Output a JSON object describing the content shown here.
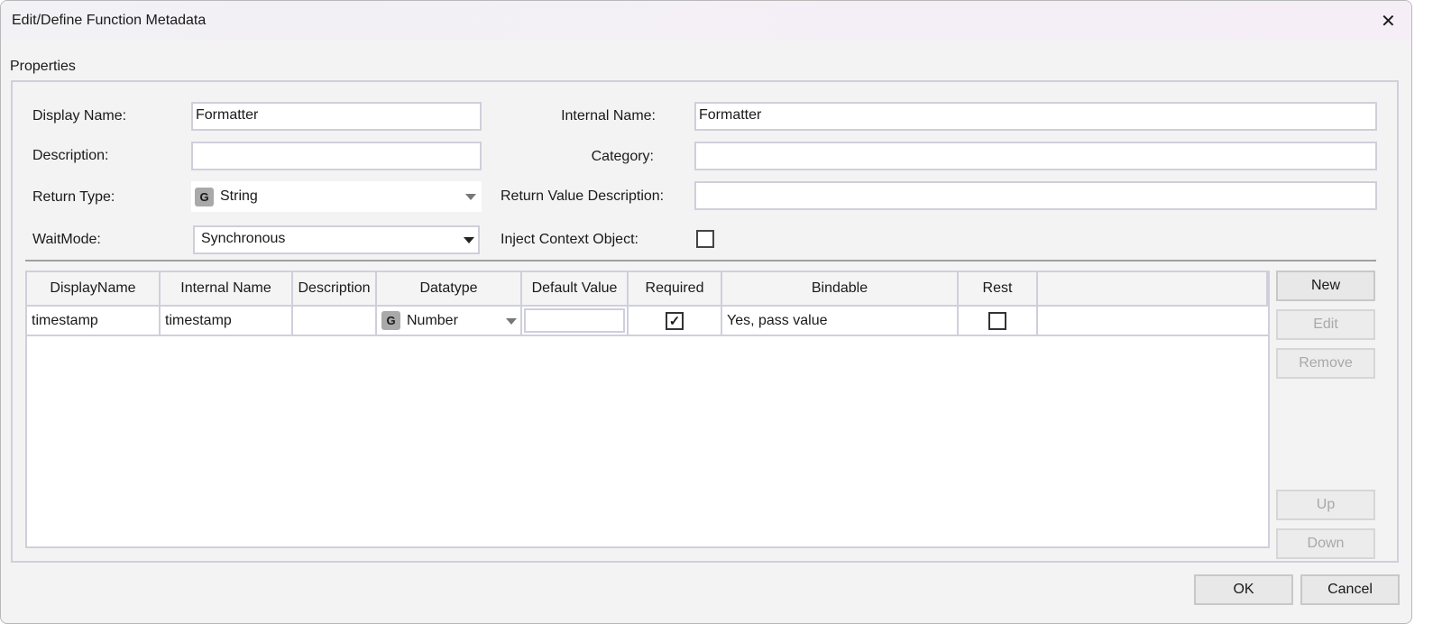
{
  "window": {
    "title": "Edit/Define Function Metadata",
    "close": "✕"
  },
  "group": {
    "label": "Properties"
  },
  "fields": {
    "display_name": {
      "label": "Display Name:",
      "value": "Formatter"
    },
    "description": {
      "label": "Description:",
      "value": ""
    },
    "return_type": {
      "label": "Return Type:",
      "badge": "G",
      "value": "String"
    },
    "wait_mode": {
      "label": "WaitMode:",
      "value": "Synchronous"
    },
    "internal_name": {
      "label": "Internal Name:",
      "value": "Formatter"
    },
    "category": {
      "label": "Category:",
      "value": ""
    },
    "return_value_description": {
      "label": "Return Value Description:",
      "value": ""
    },
    "inject_context": {
      "label": "Inject Context Object:",
      "checked": false
    }
  },
  "grid": {
    "columns": [
      "DisplayName",
      "Internal Name",
      "Description",
      "Datatype",
      "Default Value",
      "Required",
      "Bindable",
      "Rest",
      ""
    ],
    "rows": [
      {
        "display_name": "timestamp",
        "internal_name": "timestamp",
        "description": "",
        "datatype_badge": "G",
        "datatype": "Number",
        "default_value": "",
        "required": true,
        "bindable": "Yes, pass value",
        "rest": false
      }
    ]
  },
  "side_buttons": {
    "new": "New",
    "edit": "Edit",
    "remove": "Remove",
    "up": "Up",
    "down": "Down"
  },
  "footer": {
    "ok": "OK",
    "cancel": "Cancel"
  }
}
